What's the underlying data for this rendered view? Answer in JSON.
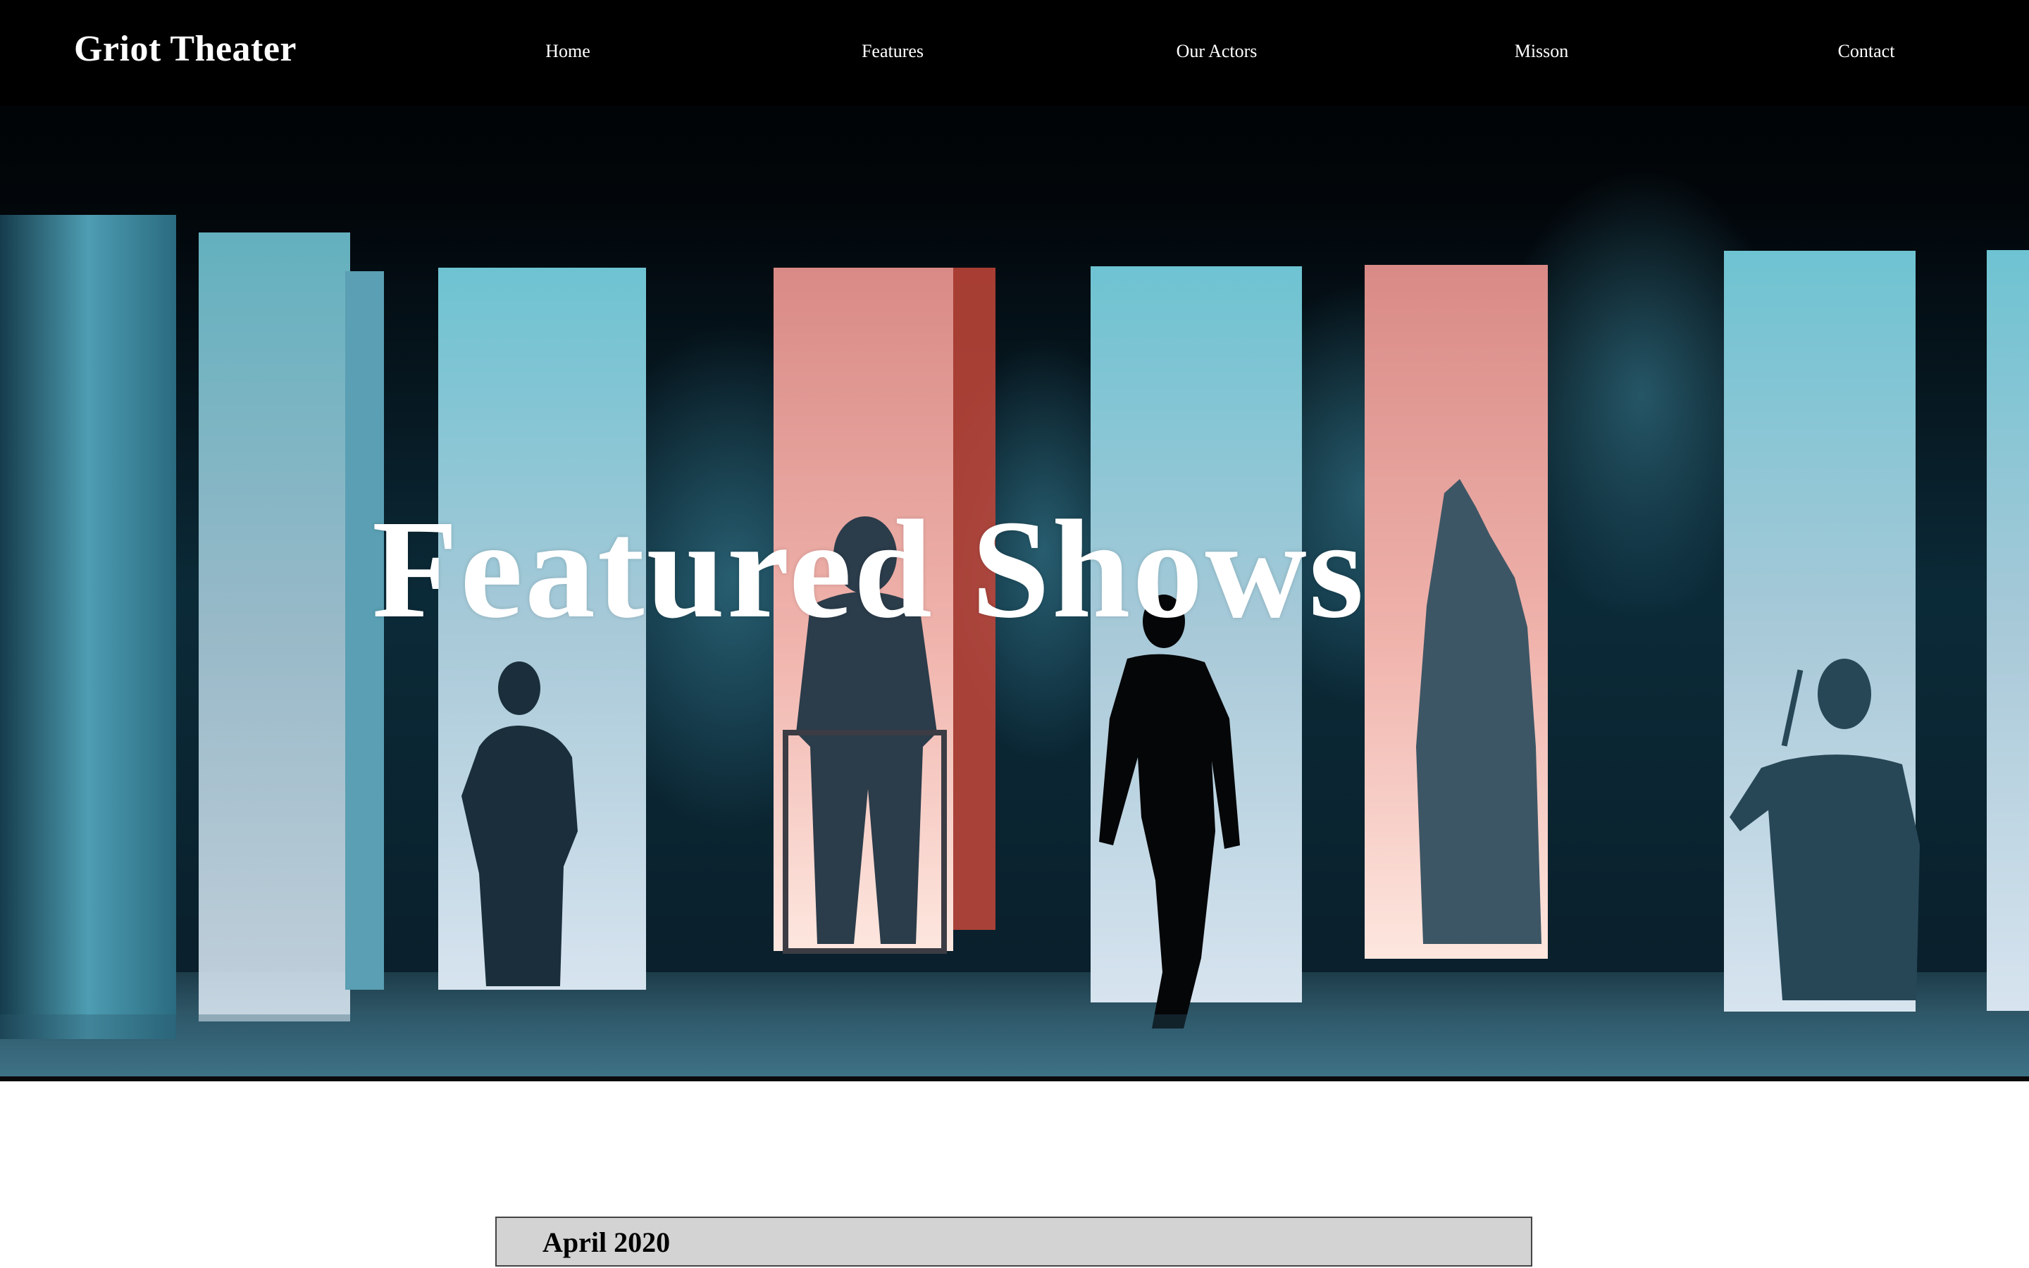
{
  "header": {
    "brand": "Griot Theater",
    "nav": [
      {
        "label": "Home"
      },
      {
        "label": "Features"
      },
      {
        "label": "Our Actors"
      },
      {
        "label": "Misson"
      },
      {
        "label": "Contact"
      }
    ]
  },
  "hero": {
    "title": "Featured Shows",
    "image_icon": "stage-silhouettes-photo"
  },
  "listing": {
    "month": "April 2020"
  },
  "colors": {
    "header_bg": "#000000",
    "text_light": "#ffffff",
    "banner_bg": "#d3d3d3",
    "banner_border": "#444444",
    "stage_teal": "#5fb6c8",
    "stage_coral": "#e9897e"
  }
}
